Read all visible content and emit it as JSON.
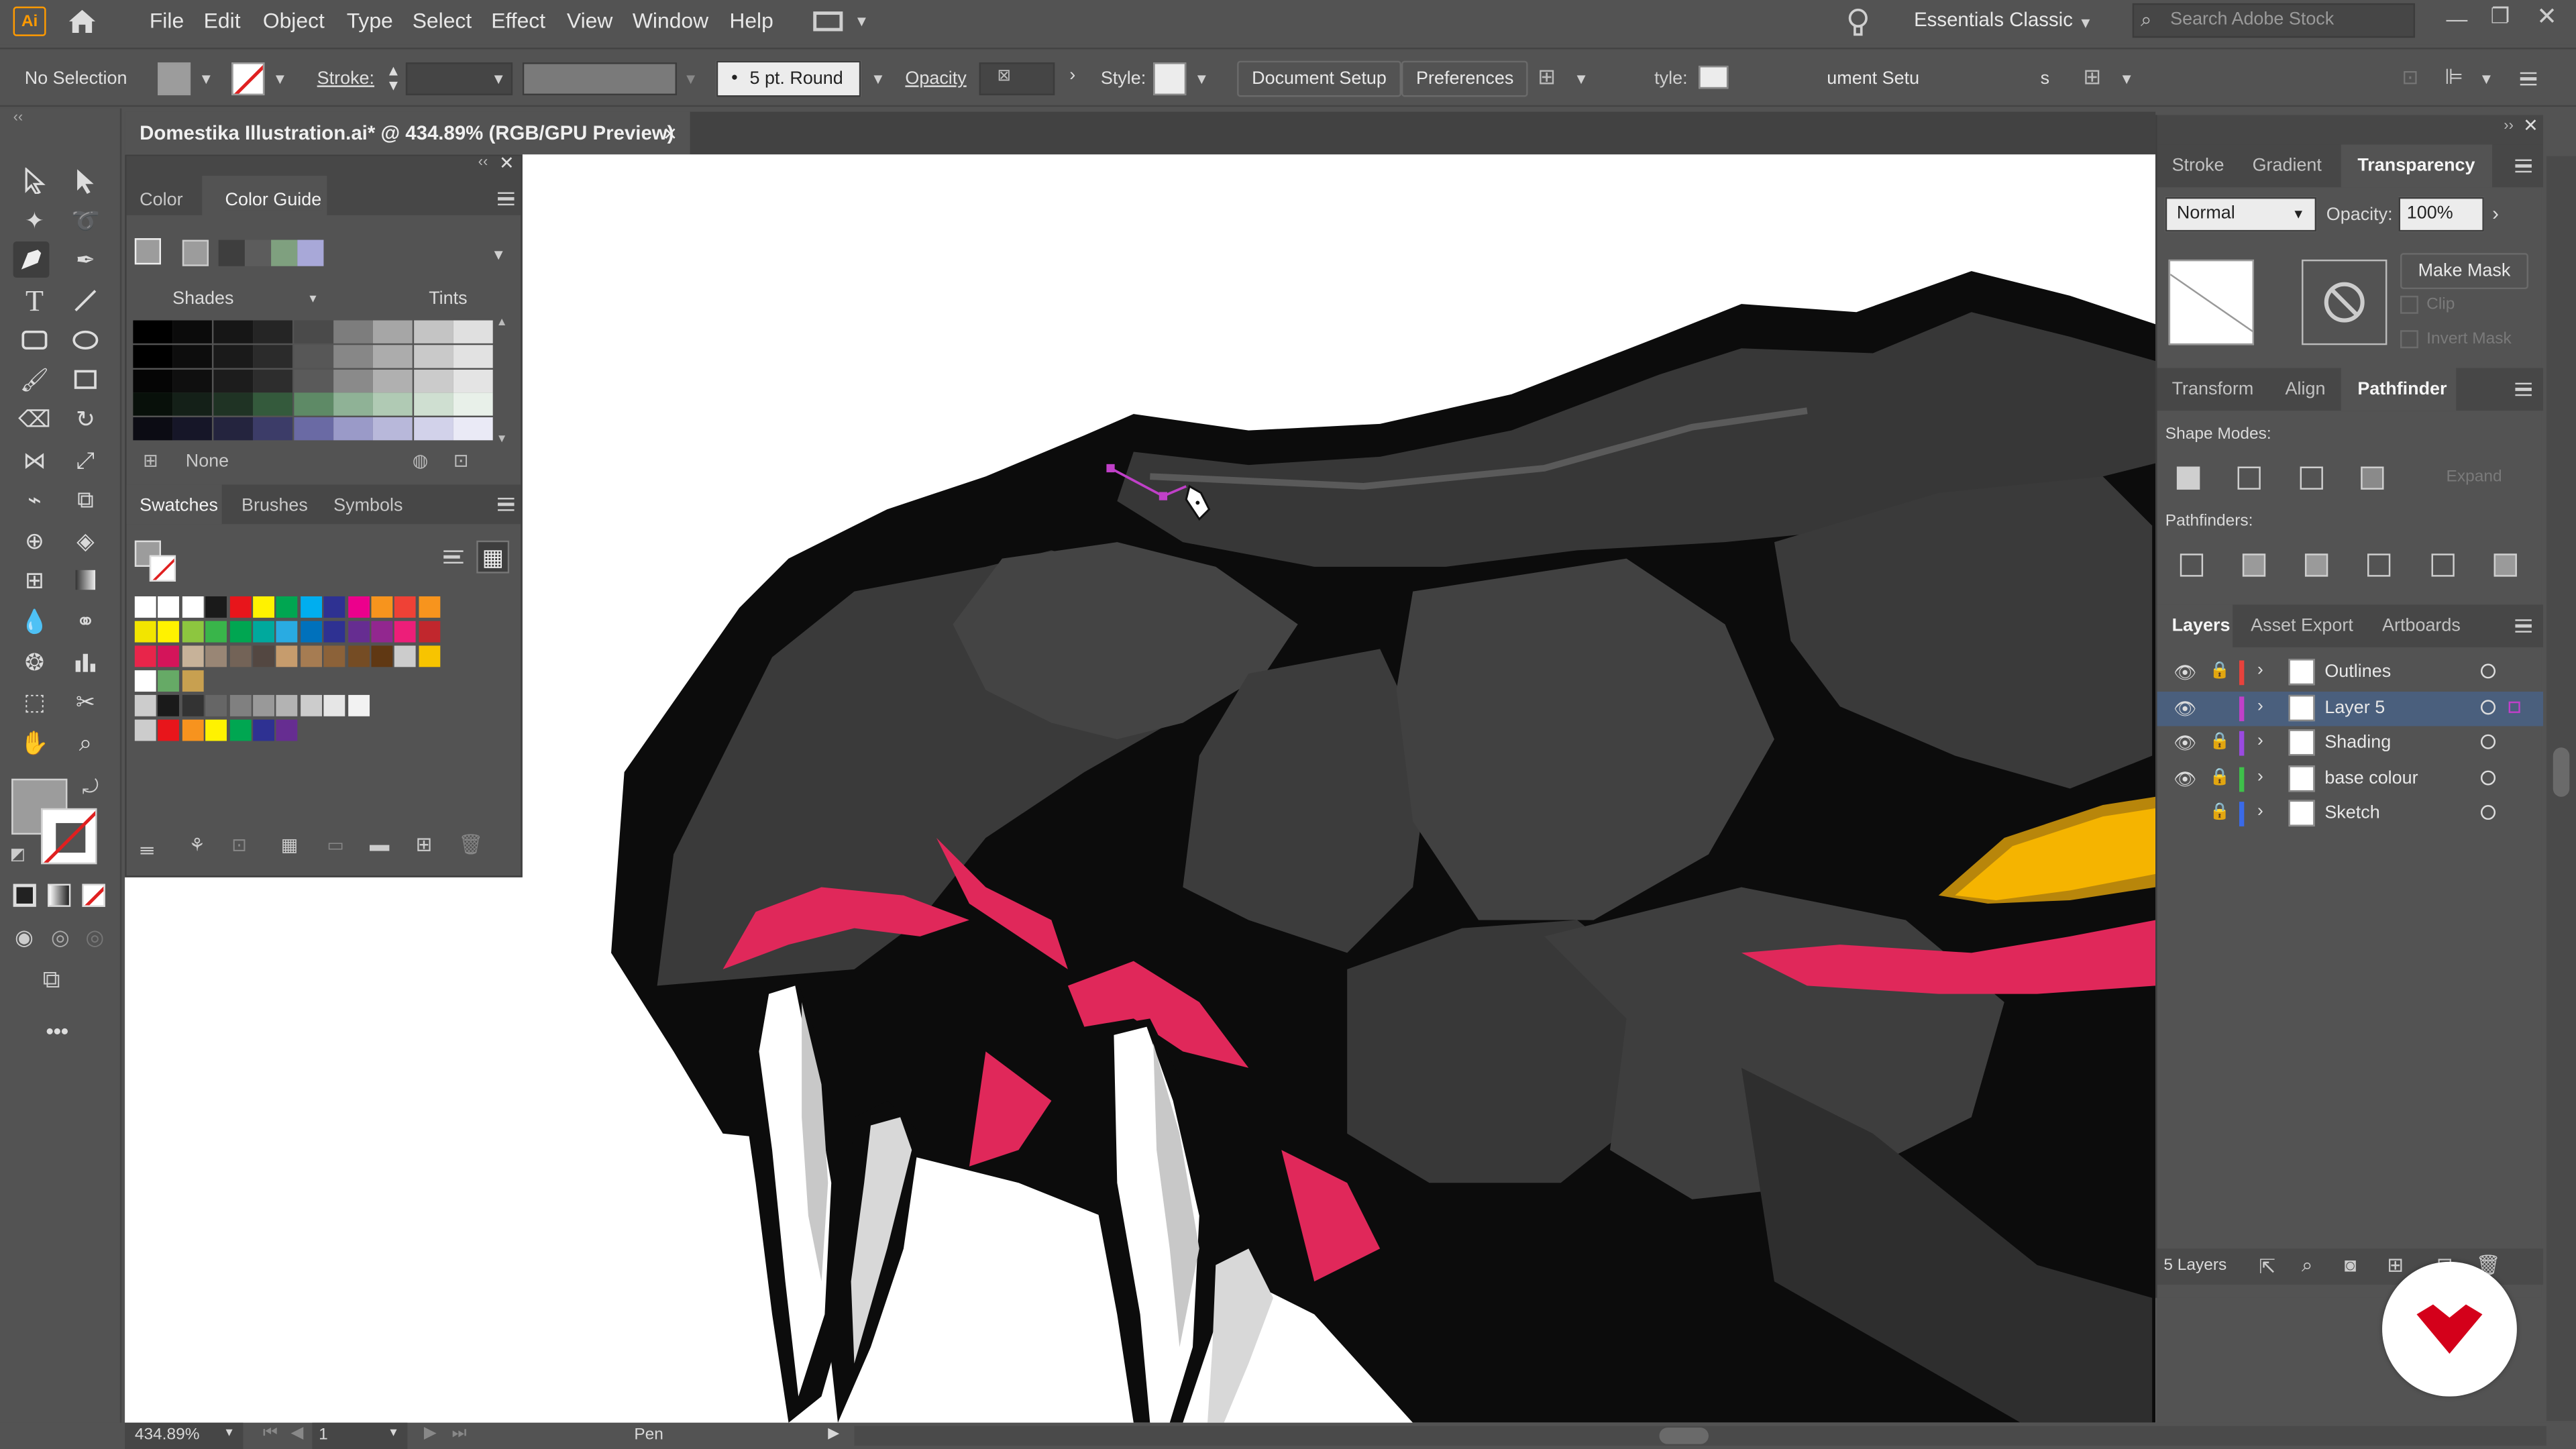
{
  "app": {
    "logo": "Ai",
    "workspace": "Essentials Classic",
    "search_placeholder": "Search Adobe Stock"
  },
  "menu": [
    "File",
    "Edit",
    "Object",
    "Type",
    "Select",
    "Effect",
    "View",
    "Window",
    "Help"
  ],
  "control_bar": {
    "selection": "No Selection",
    "stroke_label": "Stroke:",
    "brush": "5 pt. Round",
    "opacity_label": "Opacity",
    "style_label": "Style:",
    "document_setup": "Document Setup",
    "preferences": "Preferences",
    "ghost_style": "tyle:",
    "ghost_docsetup": "ument Setu",
    "ghost_s": "s"
  },
  "document_tab": {
    "title": "Domestika Illustration.ai* @ 434.89% (RGB/GPU Preview)",
    "close": "×"
  },
  "left_panel": {
    "tabs": [
      "Color",
      "Color Guide"
    ],
    "shades_label": "Shades",
    "tints_label": "Tints",
    "none_label": "None",
    "tabs2": [
      "Swatches",
      "Brushes",
      "Symbols"
    ]
  },
  "right_panel": {
    "tabs_top": [
      "Stroke",
      "Gradient",
      "Transparency"
    ],
    "blend_mode": "Normal",
    "opacity_label": "Opacity:",
    "opacity_value": "100%",
    "make_mask": "Make Mask",
    "clip": "Clip",
    "invert_mask": "Invert Mask",
    "tabs_mid": [
      "Transform",
      "Align",
      "Pathfinder"
    ],
    "shape_modes": "Shape Modes:",
    "pathfinders": "Pathfinders:",
    "expand": "Expand",
    "tabs_layers": [
      "Layers",
      "Asset Export",
      "Artboards"
    ],
    "layers": [
      {
        "name": "Outlines",
        "color": "#e8423c",
        "visible": true,
        "locked": true
      },
      {
        "name": "Layer 5",
        "color": "#c040c8",
        "visible": true,
        "locked": false
      },
      {
        "name": "Shading",
        "color": "#9a4ae0",
        "visible": true,
        "locked": true
      },
      {
        "name": "base colour",
        "color": "#3ec04a",
        "visible": true,
        "locked": true
      },
      {
        "name": "Sketch",
        "color": "#3a6ae8",
        "visible": false,
        "locked": true
      }
    ],
    "layer_count": "5 Layers"
  },
  "status_bar": {
    "zoom": "434.89%",
    "artboard": "1",
    "tool": "Pen"
  },
  "colors": {
    "ui_bg": "#535353",
    "selected_layer": "#4a5f7d",
    "accent_orange": "#ff9a00",
    "creature_dark": "#3a3a3a",
    "creature_outline": "#0c0c0c",
    "creature_pink": "#e0285a",
    "creature_eye": "#f5b400"
  }
}
